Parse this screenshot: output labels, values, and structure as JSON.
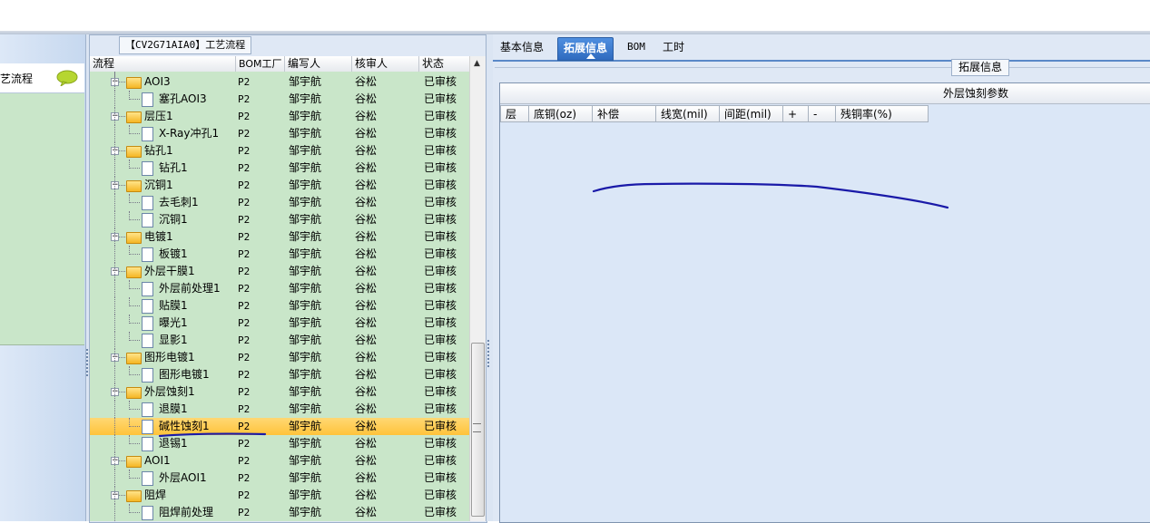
{
  "left_nav": {
    "label": "工艺流程",
    "icon": "chat-bubble-icon"
  },
  "process_panel": {
    "title": "【CV2G71AIA0】工艺流程",
    "columns": [
      "流程",
      "BOM工厂",
      "编写人",
      "核审人",
      "状态"
    ],
    "rows": [
      {
        "name": "AOI3",
        "type": "folder",
        "level": 0,
        "bom": "P2",
        "editor": "邹宇航",
        "reviewer": "谷松",
        "status": "已审核"
      },
      {
        "name": "塞孔AOI3",
        "type": "doc",
        "level": 1,
        "bom": "P2",
        "editor": "邹宇航",
        "reviewer": "谷松",
        "status": "已审核"
      },
      {
        "name": "层压1",
        "type": "folder",
        "level": 0,
        "bom": "P2",
        "editor": "邹宇航",
        "reviewer": "谷松",
        "status": "已审核"
      },
      {
        "name": "X-Ray冲孔1",
        "type": "doc",
        "level": 1,
        "bom": "P2",
        "editor": "邹宇航",
        "reviewer": "谷松",
        "status": "已审核"
      },
      {
        "name": "钻孔1",
        "type": "folder",
        "level": 0,
        "bom": "P2",
        "editor": "邹宇航",
        "reviewer": "谷松",
        "status": "已审核"
      },
      {
        "name": "钻孔1",
        "type": "doc",
        "level": 1,
        "bom": "P2",
        "editor": "邹宇航",
        "reviewer": "谷松",
        "status": "已审核"
      },
      {
        "name": "沉铜1",
        "type": "folder",
        "level": 0,
        "bom": "P2",
        "editor": "邹宇航",
        "reviewer": "谷松",
        "status": "已审核"
      },
      {
        "name": "去毛刺1",
        "type": "doc",
        "level": 1,
        "bom": "P2",
        "editor": "邹宇航",
        "reviewer": "谷松",
        "status": "已审核"
      },
      {
        "name": "沉铜1",
        "type": "doc",
        "level": 1,
        "bom": "P2",
        "editor": "邹宇航",
        "reviewer": "谷松",
        "status": "已审核"
      },
      {
        "name": "电镀1",
        "type": "folder",
        "level": 0,
        "bom": "P2",
        "editor": "邹宇航",
        "reviewer": "谷松",
        "status": "已审核"
      },
      {
        "name": "板镀1",
        "type": "doc",
        "level": 1,
        "bom": "P2",
        "editor": "邹宇航",
        "reviewer": "谷松",
        "status": "已审核"
      },
      {
        "name": "外层干膜1",
        "type": "folder",
        "level": 0,
        "bom": "P2",
        "editor": "邹宇航",
        "reviewer": "谷松",
        "status": "已审核"
      },
      {
        "name": "外层前处理1",
        "type": "doc",
        "level": 1,
        "bom": "P2",
        "editor": "邹宇航",
        "reviewer": "谷松",
        "status": "已审核"
      },
      {
        "name": "贴膜1",
        "type": "doc",
        "level": 1,
        "bom": "P2",
        "editor": "邹宇航",
        "reviewer": "谷松",
        "status": "已审核"
      },
      {
        "name": "曝光1",
        "type": "doc",
        "level": 1,
        "bom": "P2",
        "editor": "邹宇航",
        "reviewer": "谷松",
        "status": "已审核"
      },
      {
        "name": "显影1",
        "type": "doc",
        "level": 1,
        "bom": "P2",
        "editor": "邹宇航",
        "reviewer": "谷松",
        "status": "已审核"
      },
      {
        "name": "图形电镀1",
        "type": "folder",
        "level": 0,
        "bom": "P2",
        "editor": "邹宇航",
        "reviewer": "谷松",
        "status": "已审核"
      },
      {
        "name": "图形电镀1",
        "type": "doc",
        "level": 1,
        "bom": "P2",
        "editor": "邹宇航",
        "reviewer": "谷松",
        "status": "已审核"
      },
      {
        "name": "外层蚀刻1",
        "type": "folder",
        "level": 0,
        "bom": "P2",
        "editor": "邹宇航",
        "reviewer": "谷松",
        "status": "已审核"
      },
      {
        "name": "退膜1",
        "type": "doc",
        "level": 1,
        "bom": "P2",
        "editor": "邹宇航",
        "reviewer": "谷松",
        "status": "已审核"
      },
      {
        "name": "碱性蚀刻1",
        "type": "doc",
        "level": 1,
        "bom": "P2",
        "editor": "邹宇航",
        "reviewer": "谷松",
        "status": "已审核",
        "selected": true
      },
      {
        "name": "退锡1",
        "type": "doc",
        "level": 1,
        "bom": "P2",
        "editor": "邹宇航",
        "reviewer": "谷松",
        "status": "已审核"
      },
      {
        "name": "AOI1",
        "type": "folder",
        "level": 0,
        "bom": "P2",
        "editor": "邹宇航",
        "reviewer": "谷松",
        "status": "已审核"
      },
      {
        "name": "外层AOI1",
        "type": "doc",
        "level": 1,
        "bom": "P2",
        "editor": "邹宇航",
        "reviewer": "谷松",
        "status": "已审核"
      },
      {
        "name": "阻焊",
        "type": "folder",
        "level": 0,
        "bom": "P2",
        "editor": "邹宇航",
        "reviewer": "谷松",
        "status": "已审核"
      },
      {
        "name": "阻焊前处理",
        "type": "doc",
        "level": 1,
        "bom": "P2",
        "editor": "邹宇航",
        "reviewer": "谷松",
        "status": "已审核"
      }
    ]
  },
  "tabs": [
    {
      "label": "基本信息",
      "active": false
    },
    {
      "label": "拓展信息",
      "active": true
    },
    {
      "label": "BOM",
      "active": false
    },
    {
      "label": "工时",
      "active": false
    }
  ],
  "ext_panel": {
    "group_title": "拓展信息",
    "table_title": "外层蚀刻参数",
    "columns": [
      "层",
      "底铜(oz)",
      "补偿",
      "线宽(mil)",
      "间距(mil)",
      "+",
      "-",
      "残铜率(%)"
    ]
  },
  "colors": {
    "tree_bg": "#c9e6c9",
    "selected_row": "#ffc33a",
    "tab_active": "#3a7ad0",
    "annotation_stroke": "#1a1aa8"
  }
}
